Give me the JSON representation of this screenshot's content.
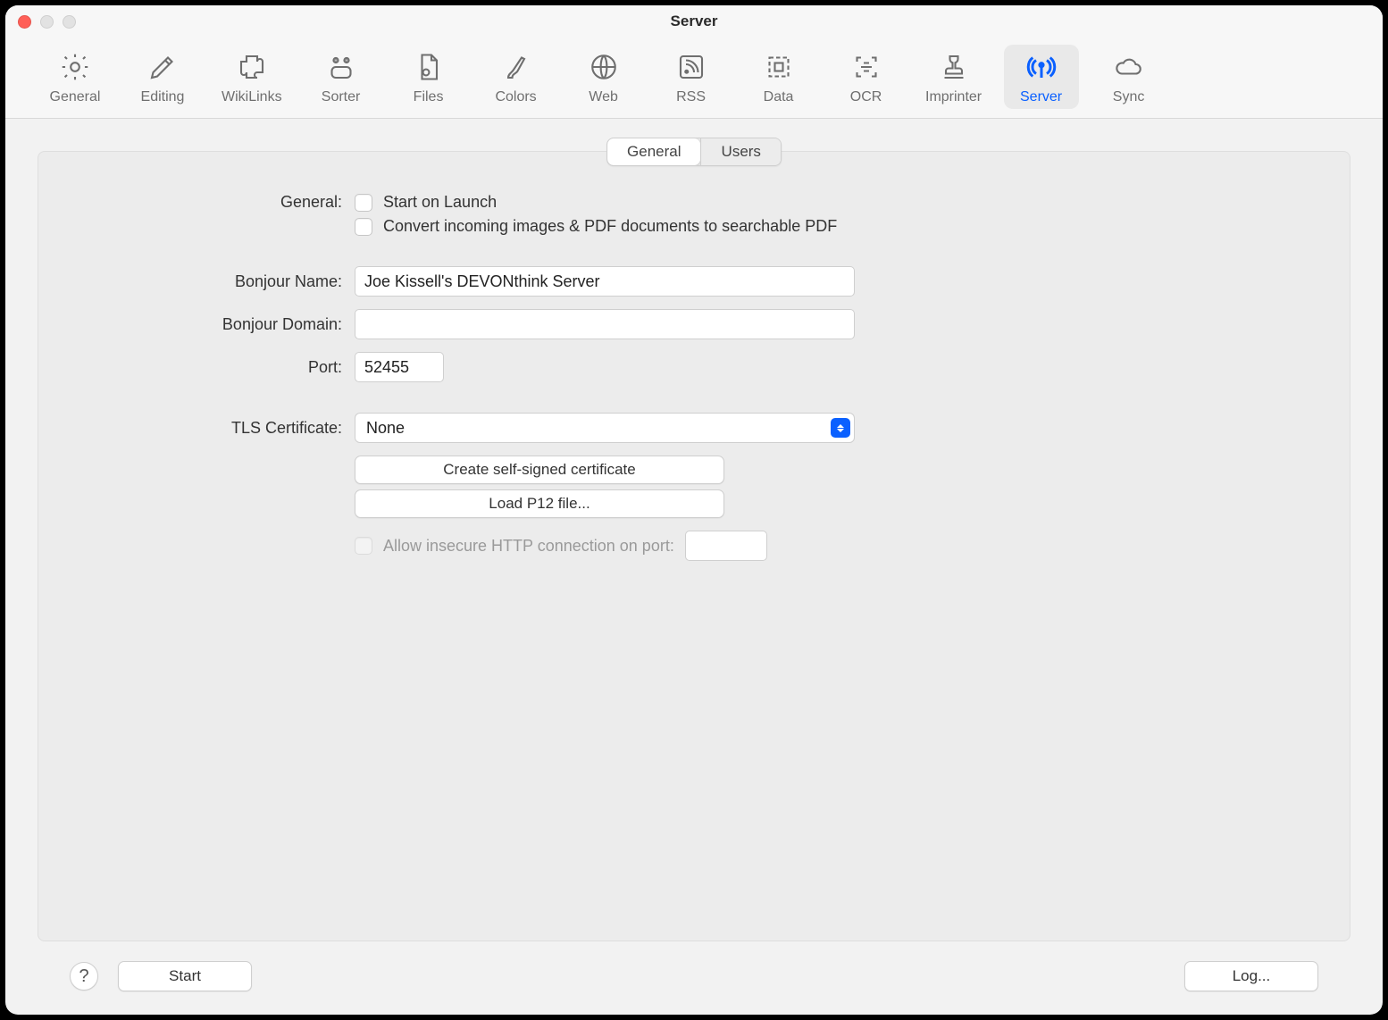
{
  "window_title": "Server",
  "toolbar": {
    "items": [
      {
        "label": "General"
      },
      {
        "label": "Editing"
      },
      {
        "label": "WikiLinks"
      },
      {
        "label": "Sorter"
      },
      {
        "label": "Files"
      },
      {
        "label": "Colors"
      },
      {
        "label": "Web"
      },
      {
        "label": "RSS"
      },
      {
        "label": "Data"
      },
      {
        "label": "OCR"
      },
      {
        "label": "Imprinter"
      },
      {
        "label": "Server"
      },
      {
        "label": "Sync"
      }
    ]
  },
  "tabs": {
    "general": "General",
    "users": "Users"
  },
  "labels": {
    "general": "General:",
    "bonjour_name": "Bonjour Name:",
    "bonjour_domain": "Bonjour Domain:",
    "port": "Port:",
    "tls_certificate": "TLS Certificate:"
  },
  "checks": {
    "start_on_launch": "Start on Launch",
    "convert_pdf": "Convert incoming images & PDF documents to searchable PDF",
    "allow_insecure": "Allow insecure HTTP connection on port:"
  },
  "fields": {
    "bonjour_name": "Joe Kissell's DEVONthink Server",
    "bonjour_domain": "",
    "port": "52455",
    "tls_select": "None",
    "insecure_port": ""
  },
  "buttons": {
    "create_cert": "Create self-signed certificate",
    "load_p12": "Load P12 file...",
    "help": "?",
    "start": "Start",
    "log": "Log..."
  }
}
